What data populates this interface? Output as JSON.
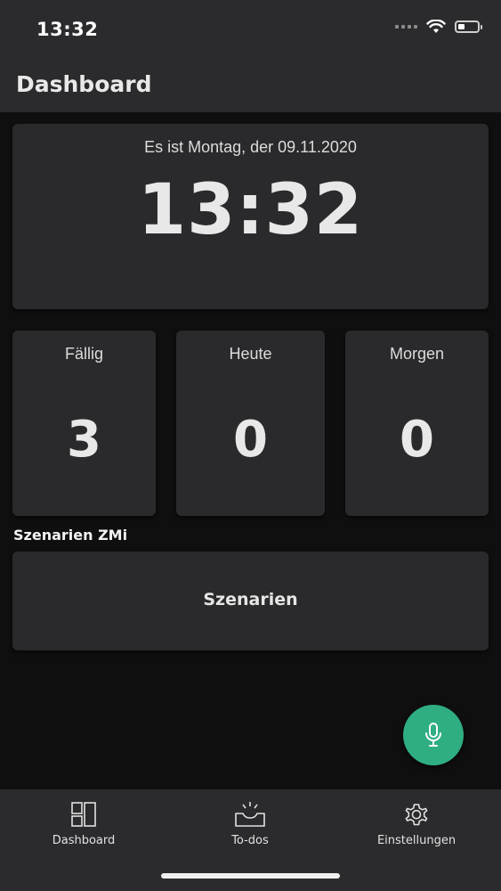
{
  "status_bar": {
    "time": "13:32"
  },
  "header": {
    "title": "Dashboard"
  },
  "clock_card": {
    "date_text": "Es ist Montag, der 09.11.2020",
    "time": "13:32"
  },
  "stats": [
    {
      "label": "Fällig",
      "value": "3"
    },
    {
      "label": "Heute",
      "value": "0"
    },
    {
      "label": "Morgen",
      "value": "0"
    }
  ],
  "scenarios": {
    "section_title": "Szenarien ZMi",
    "button_label": "Szenarien"
  },
  "fab": {
    "icon": "microphone-icon",
    "color": "#2fae82"
  },
  "tabbar": {
    "items": [
      {
        "label": "Dashboard",
        "icon": "dashboard-icon"
      },
      {
        "label": "To-dos",
        "icon": "todos-tray-icon"
      },
      {
        "label": "Einstellungen",
        "icon": "gear-icon"
      }
    ]
  },
  "colors": {
    "background": "#0f0f10",
    "surface": "#2a2a2c",
    "bar": "#2b2b2d",
    "accent": "#2fae82"
  }
}
